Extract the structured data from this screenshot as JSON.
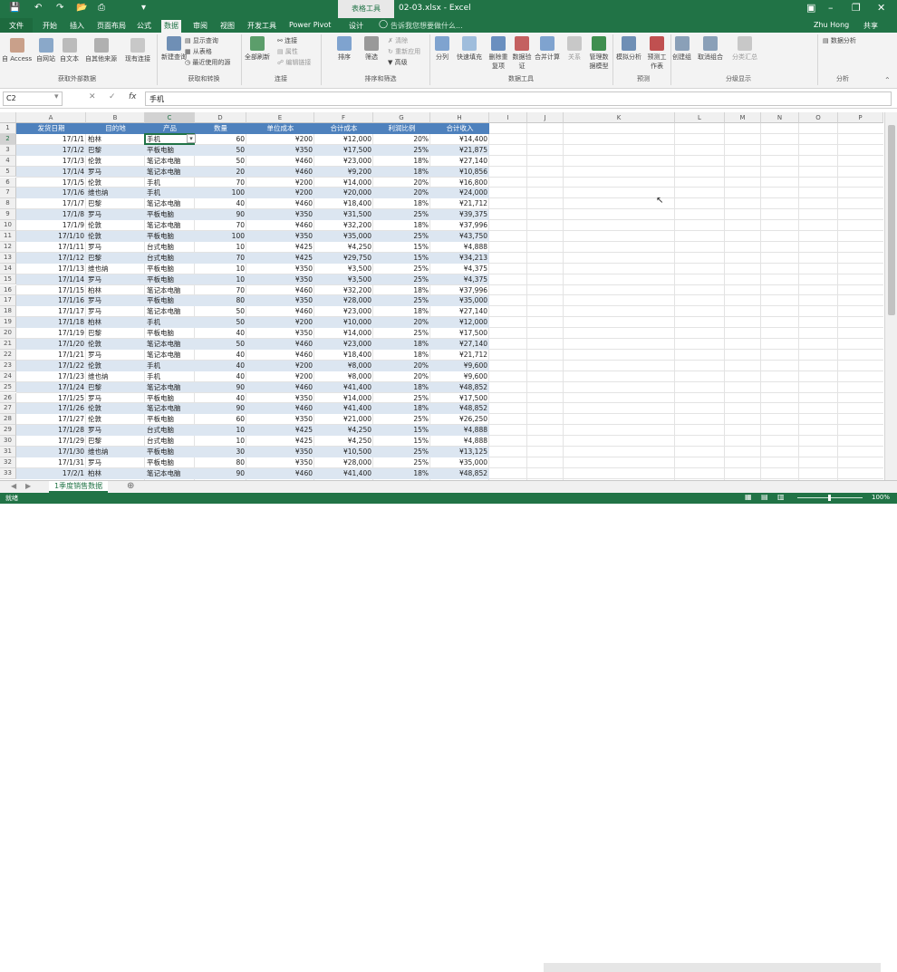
{
  "window": {
    "title": "02-03.xlsx - Excel",
    "context_tab": "表格工具",
    "user": "Zhu Hong",
    "share": "共享"
  },
  "tabs": [
    "文件",
    "开始",
    "插入",
    "页面布局",
    "公式",
    "数据",
    "审阅",
    "视图",
    "开发工具",
    "Power Pivot",
    "设计"
  ],
  "active_tab": "数据",
  "tell_me": "告诉我您想要做什么...",
  "ribbon": {
    "external": [
      "自 Access",
      "自网站",
      "自文本",
      "自其他来源",
      "现有连接"
    ],
    "external_group": "获取外部数据",
    "new_query": "新建查询",
    "transform": [
      "显示查询",
      "从表格",
      "最近使用的源"
    ],
    "transform_group": "获取和转换",
    "refresh_all": "全部刷新",
    "connections": [
      "连接",
      "属性",
      "编辑链接"
    ],
    "connections_group": "连接",
    "sort": "排序",
    "filter": "筛选",
    "filter_opts": [
      "清除",
      "重新应用",
      "高级"
    ],
    "sort_group": "排序和筛选",
    "tools": [
      "分列",
      "快速填充",
      "删除重复项",
      "数据验证",
      "合并计算",
      "关系",
      "管理数据模型"
    ],
    "tools_group": "数据工具",
    "forecast": [
      "模拟分析",
      "预测工作表"
    ],
    "forecast_group": "预测",
    "outline": [
      "创建组",
      "取消组合",
      "分类汇总"
    ],
    "outline_group": "分级显示",
    "analysis": "数据分析",
    "analysis_group": "分析"
  },
  "formula_bar": {
    "cell": "C2",
    "fx": "fx",
    "value": "手机"
  },
  "columns": [
    "A",
    "B",
    "C",
    "D",
    "E",
    "F",
    "G",
    "H",
    "I",
    "J",
    "K",
    "L",
    "M",
    "N",
    "O",
    "P"
  ],
  "headers": [
    "发货日期",
    "目的地",
    "产品",
    "数量",
    "单位成本",
    "合计成本",
    "利润比例",
    "合计收入"
  ],
  "rows": [
    [
      "17/1/1",
      "柏林",
      "手机",
      "60",
      "¥200",
      "¥12,000",
      "20%",
      "¥14,400"
    ],
    [
      "17/1/2",
      "巴黎",
      "平板电脑",
      "50",
      "¥350",
      "¥17,500",
      "25%",
      "¥21,875"
    ],
    [
      "17/1/3",
      "伦敦",
      "笔记本电脑",
      "50",
      "¥460",
      "¥23,000",
      "18%",
      "¥27,140"
    ],
    [
      "17/1/4",
      "罗马",
      "笔记本电脑",
      "20",
      "¥460",
      "¥9,200",
      "18%",
      "¥10,856"
    ],
    [
      "17/1/5",
      "伦敦",
      "手机",
      "70",
      "¥200",
      "¥14,000",
      "20%",
      "¥16,800"
    ],
    [
      "17/1/6",
      "维也纳",
      "手机",
      "100",
      "¥200",
      "¥20,000",
      "20%",
      "¥24,000"
    ],
    [
      "17/1/7",
      "巴黎",
      "笔记本电脑",
      "40",
      "¥460",
      "¥18,400",
      "18%",
      "¥21,712"
    ],
    [
      "17/1/8",
      "罗马",
      "平板电脑",
      "90",
      "¥350",
      "¥31,500",
      "25%",
      "¥39,375"
    ],
    [
      "17/1/9",
      "伦敦",
      "笔记本电脑",
      "70",
      "¥460",
      "¥32,200",
      "18%",
      "¥37,996"
    ],
    [
      "17/1/10",
      "伦敦",
      "平板电脑",
      "100",
      "¥350",
      "¥35,000",
      "25%",
      "¥43,750"
    ],
    [
      "17/1/11",
      "罗马",
      "台式电脑",
      "10",
      "¥425",
      "¥4,250",
      "15%",
      "¥4,888"
    ],
    [
      "17/1/12",
      "巴黎",
      "台式电脑",
      "70",
      "¥425",
      "¥29,750",
      "15%",
      "¥34,213"
    ],
    [
      "17/1/13",
      "维也纳",
      "平板电脑",
      "10",
      "¥350",
      "¥3,500",
      "25%",
      "¥4,375"
    ],
    [
      "17/1/14",
      "罗马",
      "平板电脑",
      "10",
      "¥350",
      "¥3,500",
      "25%",
      "¥4,375"
    ],
    [
      "17/1/15",
      "柏林",
      "笔记本电脑",
      "70",
      "¥460",
      "¥32,200",
      "18%",
      "¥37,996"
    ],
    [
      "17/1/16",
      "罗马",
      "平板电脑",
      "80",
      "¥350",
      "¥28,000",
      "25%",
      "¥35,000"
    ],
    [
      "17/1/17",
      "罗马",
      "笔记本电脑",
      "50",
      "¥460",
      "¥23,000",
      "18%",
      "¥27,140"
    ],
    [
      "17/1/18",
      "柏林",
      "手机",
      "50",
      "¥200",
      "¥10,000",
      "20%",
      "¥12,000"
    ],
    [
      "17/1/19",
      "巴黎",
      "平板电脑",
      "40",
      "¥350",
      "¥14,000",
      "25%",
      "¥17,500"
    ],
    [
      "17/1/20",
      "伦敦",
      "笔记本电脑",
      "50",
      "¥460",
      "¥23,000",
      "18%",
      "¥27,140"
    ],
    [
      "17/1/21",
      "罗马",
      "笔记本电脑",
      "40",
      "¥460",
      "¥18,400",
      "18%",
      "¥21,712"
    ],
    [
      "17/1/22",
      "伦敦",
      "手机",
      "40",
      "¥200",
      "¥8,000",
      "20%",
      "¥9,600"
    ],
    [
      "17/1/23",
      "维也纳",
      "手机",
      "40",
      "¥200",
      "¥8,000",
      "20%",
      "¥9,600"
    ],
    [
      "17/1/24",
      "巴黎",
      "笔记本电脑",
      "90",
      "¥460",
      "¥41,400",
      "18%",
      "¥48,852"
    ],
    [
      "17/1/25",
      "罗马",
      "平板电脑",
      "40",
      "¥350",
      "¥14,000",
      "25%",
      "¥17,500"
    ],
    [
      "17/1/26",
      "伦敦",
      "笔记本电脑",
      "90",
      "¥460",
      "¥41,400",
      "18%",
      "¥48,852"
    ],
    [
      "17/1/27",
      "伦敦",
      "平板电脑",
      "60",
      "¥350",
      "¥21,000",
      "25%",
      "¥26,250"
    ],
    [
      "17/1/28",
      "罗马",
      "台式电脑",
      "10",
      "¥425",
      "¥4,250",
      "15%",
      "¥4,888"
    ],
    [
      "17/1/29",
      "巴黎",
      "台式电脑",
      "10",
      "¥425",
      "¥4,250",
      "15%",
      "¥4,888"
    ],
    [
      "17/1/30",
      "维也纳",
      "平板电脑",
      "30",
      "¥350",
      "¥10,500",
      "25%",
      "¥13,125"
    ],
    [
      "17/1/31",
      "罗马",
      "平板电脑",
      "80",
      "¥350",
      "¥28,000",
      "25%",
      "¥35,000"
    ],
    [
      "17/2/1",
      "柏林",
      "笔记本电脑",
      "90",
      "¥460",
      "¥41,400",
      "18%",
      "¥48,852"
    ]
  ],
  "row_numbers": [
    "1",
    "2",
    "3",
    "4",
    "5",
    "6",
    "7",
    "8",
    "9",
    "10",
    "11",
    "12",
    "13",
    "14",
    "15",
    "16",
    "17",
    "18",
    "19",
    "20",
    "21",
    "22",
    "23",
    "24",
    "25",
    "26",
    "27",
    "28",
    "29",
    "30",
    "31",
    "32",
    "33"
  ],
  "sheet_tab": "1季度销售数据",
  "status": {
    "ready": "就绪",
    "zoom": "100%"
  }
}
